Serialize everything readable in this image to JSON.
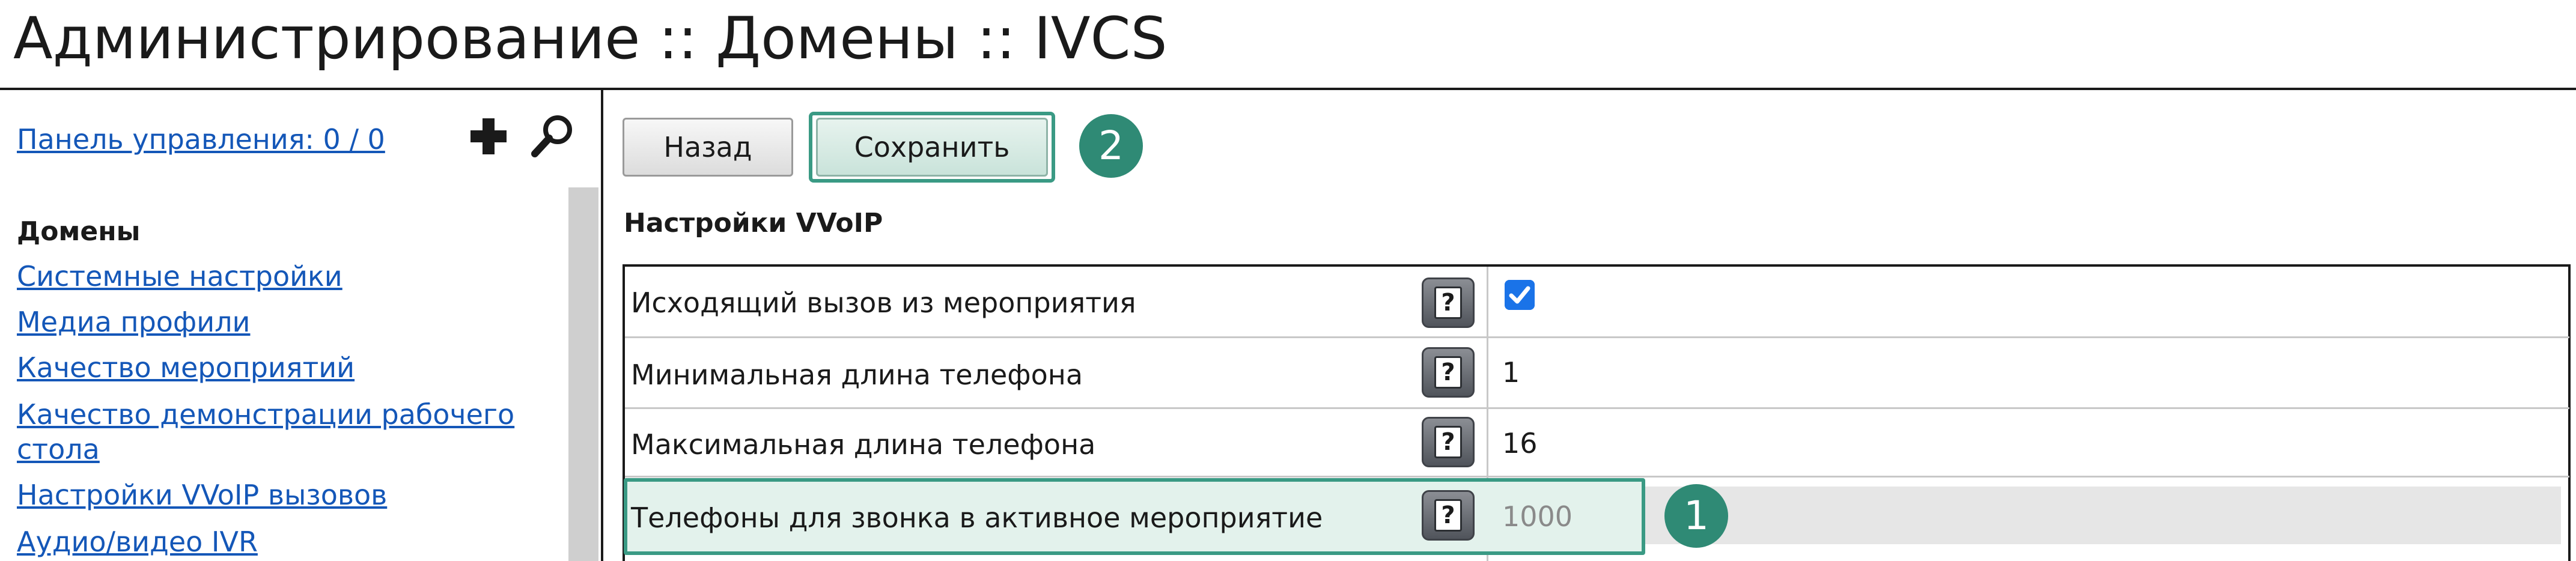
{
  "header": {
    "title": "Администрирование :: Домены :: IVCS"
  },
  "sidebar": {
    "control_panel_link": "Панель управления: 0 / 0",
    "add_icon": "plus-icon",
    "search_icon": "magnifier-icon",
    "section_heading": "Домены",
    "items": [
      {
        "label": "Системные настройки"
      },
      {
        "label": "Медиа профили"
      },
      {
        "label": "Качество мероприятий"
      },
      {
        "label_line1": "Качество демонстрации рабочего",
        "label_line2": "стола"
      },
      {
        "label": "Настройки VVoIP вызовов"
      },
      {
        "label": "Аудио/видео IVR"
      }
    ]
  },
  "toolbar": {
    "back_label": "Назад",
    "save_label": "Сохранить"
  },
  "badges": {
    "save_step": "2",
    "field_step": "1"
  },
  "section": {
    "title": "Настройки VVoIP"
  },
  "settings": [
    {
      "label": "Исходящий вызов из мероприятия",
      "help": "?",
      "checked": true
    },
    {
      "label": "Минимальная длина телефона",
      "help": "?",
      "value": "1"
    },
    {
      "label": "Максимальная длина телефона",
      "help": "?",
      "value": "16"
    },
    {
      "label": "Телефоны для звонка в активное мероприятие",
      "help": "?",
      "placeholder": "1000"
    }
  ],
  "colors": {
    "link": "#1457b8",
    "highlight_border": "#3a9a84",
    "highlight_fill": "#e3f2ec",
    "badge": "#2f8a75",
    "checkbox": "#1a73e8"
  }
}
